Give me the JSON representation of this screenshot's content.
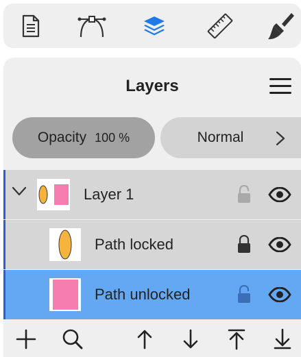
{
  "toolbar": {
    "items": [
      {
        "icon": "document-icon"
      },
      {
        "icon": "pen-tool-icon"
      },
      {
        "icon": "layers-icon",
        "active": true
      },
      {
        "icon": "ruler-icon"
      },
      {
        "icon": "brush-icon"
      }
    ],
    "active_color": "#1f7ae8"
  },
  "panel": {
    "title": "Layers",
    "opacity": {
      "label": "Opacity",
      "value": "100 %"
    },
    "blend_mode": "Normal"
  },
  "layers": [
    {
      "label": "Layer 1",
      "locked": false,
      "visible": true,
      "expanded": true
    },
    {
      "label": "Path locked",
      "locked": true,
      "visible": true
    },
    {
      "label": "Path unlocked",
      "locked": false,
      "visible": true,
      "selected": true
    }
  ],
  "colors": {
    "ellipse_fill": "#f6b43f",
    "rect_fill": "#f57db0",
    "selected_row": "#64a8f4",
    "accent": "#1f63d6"
  },
  "bottom_toolbar": {
    "items": [
      "plus-icon",
      "search-icon",
      "arrow-up-icon",
      "arrow-down-icon",
      "arrow-to-top-icon",
      "arrow-to-bottom-icon"
    ]
  }
}
